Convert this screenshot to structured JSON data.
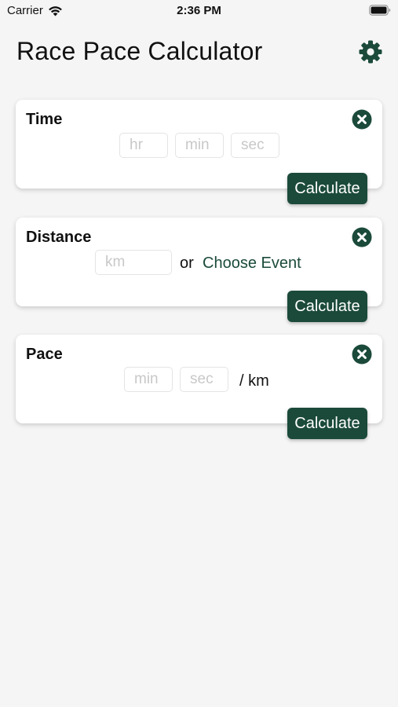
{
  "status_bar": {
    "carrier": "Carrier",
    "time": "2:36 PM",
    "icons": [
      "wifi-icon",
      "battery-icon"
    ]
  },
  "header": {
    "title": "Race Pace Calculator",
    "settings_icon": "gear-icon"
  },
  "colors": {
    "accent": "#1b4a3a",
    "background": "#f5f5f5",
    "card": "#ffffff",
    "placeholder": "#c8c8c8"
  },
  "time_card": {
    "title": "Time",
    "hours_placeholder": "hr",
    "minutes_placeholder": "min",
    "seconds_placeholder": "sec",
    "hours_value": "",
    "minutes_value": "",
    "seconds_value": "",
    "clear_icon": "x-circle-icon",
    "calculate_label": "Calculate"
  },
  "distance_card": {
    "title": "Distance",
    "km_placeholder": "km",
    "km_value": "",
    "or_label": "or",
    "choose_event_label": "Choose Event",
    "clear_icon": "x-circle-icon",
    "calculate_label": "Calculate"
  },
  "pace_card": {
    "title": "Pace",
    "minutes_placeholder": "min",
    "seconds_placeholder": "sec",
    "minutes_value": "",
    "seconds_value": "",
    "unit_label": "/ km",
    "clear_icon": "x-circle-icon",
    "calculate_label": "Calculate"
  }
}
